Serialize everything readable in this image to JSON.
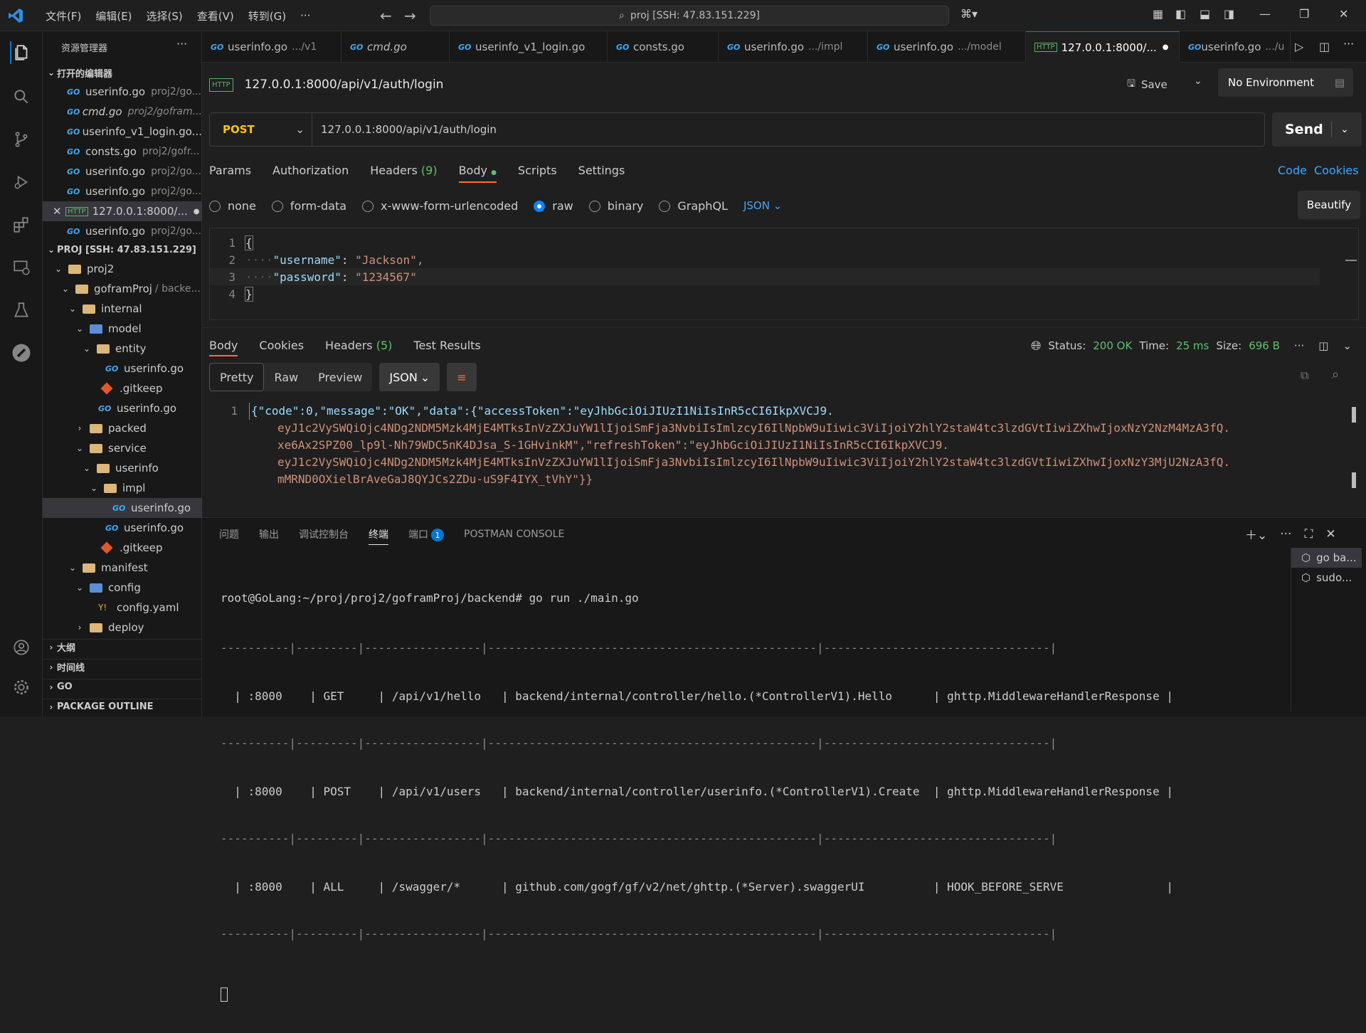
{
  "titlebar": {
    "menu": [
      "文件(F)",
      "编辑(E)",
      "选择(S)",
      "查看(V)",
      "转到(G)",
      "···"
    ],
    "search": "proj [SSH: 47.83.151.229]"
  },
  "sidebar": {
    "header": "资源管理器",
    "open_editors_title": "打开的编辑器",
    "open_editors": [
      {
        "name": "userinfo.go",
        "path": "proj2/go..."
      },
      {
        "name": "cmd.go",
        "path": "proj2/gofram..."
      },
      {
        "name": "userinfo_v1_login.go...",
        "path": ""
      },
      {
        "name": "consts.go",
        "path": "proj2/gofr..."
      },
      {
        "name": "userinfo.go",
        "path": "proj2/go..."
      },
      {
        "name": "userinfo.go",
        "path": "proj2/go..."
      },
      {
        "name": "127.0.0.1:8000/...",
        "path": ""
      },
      {
        "name": "userinfo.go",
        "path": "proj2/go..."
      }
    ],
    "proj_title": "PROJ [SSH: 47.83.151.229]",
    "tree": [
      {
        "label": "proj2"
      },
      {
        "label": "goframProj",
        "path": "/ backe..."
      },
      {
        "label": "internal"
      },
      {
        "label": "model"
      },
      {
        "label": "entity"
      },
      {
        "label": "userinfo.go"
      },
      {
        "label": ".gitkeep"
      },
      {
        "label": "userinfo.go"
      },
      {
        "label": "packed"
      },
      {
        "label": "service"
      },
      {
        "label": "userinfo"
      },
      {
        "label": "impl"
      },
      {
        "label": "userinfo.go"
      },
      {
        "label": "userinfo.go"
      },
      {
        "label": ".gitkeep"
      },
      {
        "label": "manifest"
      },
      {
        "label": "config"
      },
      {
        "label": "config.yaml"
      },
      {
        "label": "deploy"
      }
    ],
    "bottom_sections": [
      "大纲",
      "时间线",
      "GO",
      "PACKAGE OUTLINE"
    ]
  },
  "tabs": [
    {
      "name": "userinfo.go",
      "path": ".../v1"
    },
    {
      "name": "cmd.go",
      "path": ""
    },
    {
      "name": "userinfo_v1_login.go",
      "path": ""
    },
    {
      "name": "consts.go",
      "path": ""
    },
    {
      "name": "userinfo.go",
      "path": ".../impl"
    },
    {
      "name": "userinfo.go",
      "path": ".../model"
    },
    {
      "name": "127.0.0.1:8000/...",
      "path": ""
    },
    {
      "name": "userinfo.go",
      "path": ".../u"
    }
  ],
  "request": {
    "title": "127.0.0.1:8000/api/v1/auth/login",
    "save": "Save",
    "environment": "No Environment",
    "method": "POST",
    "url": "127.0.0.1:8000/api/v1/auth/login",
    "send": "Send",
    "subtabs": {
      "params": "Params",
      "authorization": "Authorization",
      "headers": "Headers",
      "headers_count": "(9)",
      "body": "Body",
      "scripts": "Scripts",
      "settings": "Settings"
    },
    "code": "Code",
    "cookies": "Cookies",
    "body_types": [
      "none",
      "form-data",
      "x-www-form-urlencoded",
      "raw",
      "binary",
      "GraphQL"
    ],
    "body_format": "JSON",
    "beautify": "Beautify",
    "body_lines": [
      {
        "n": "1",
        "text": "{"
      },
      {
        "n": "2",
        "key": "\"username\"",
        "value": "\"Jackson\","
      },
      {
        "n": "3",
        "key": "\"password\"",
        "value": "\"1234567\""
      },
      {
        "n": "4",
        "text": "}"
      }
    ]
  },
  "response": {
    "tabs": {
      "body": "Body",
      "cookies": "Cookies",
      "headers": "Headers",
      "headers_count": "(5)",
      "tests": "Test Results"
    },
    "status_label": "Status:",
    "status": "200 OK",
    "time_label": "Time:",
    "time": "25 ms",
    "size_label": "Size:",
    "size": "696 B",
    "views": [
      "Pretty",
      "Raw",
      "Preview"
    ],
    "format": "JSON",
    "line_no": "1",
    "lines": [
      "{\"code\":0,\"message\":\"OK\",\"data\":{\"accessToken\":\"eyJhbGciOiJIUzI1NiIsInR5cCI6IkpXVCJ9.",
      "eyJ1c2VySWQiOjc4NDg2NDM5Mzk4MjE4MTksInVzZXJuYW1lIjoiSmFja3NvbiIsImlzcyI6IlNpbW9uIiwic3ViIjoiY2hlY2staW4tc3lzdGVtIiwiZXhwIjoxNzY2NzM4MzA3fQ.",
      "xe6Ax2SPZ00_lp9l-Nh79WDC5nK4DJsa_S-1GHvinkM\",\"refreshToken\":\"eyJhbGciOiJIUzI1NiIsInR5cCI6IkpXVCJ9.",
      "eyJ1c2VySWQiOjc4NDg2NDM5Mzk4MjE4MTksInVzZXJuYW1lIjoiSmFja3NvbiIsImlzcyI6IlNpbW9uIiwic3ViIjoiY2hlY2staW4tc3lzdGVtIiwiZXhwIjoxNzY3MjU2NzA3fQ.",
      "mMRND0OXielBrAveGaJ8QYJCs2ZDu-uS9F4IYX_tVhY\"}}"
    ]
  },
  "panel": {
    "tabs": [
      "问题",
      "输出",
      "调试控制台",
      "终端",
      "端口",
      "POSTMAN CONSOLE"
    ],
    "port_badge": "1",
    "terminal_lines": [
      "root@GoLang:~/proj/proj2/goframProj/backend# go run ./main.go",
      "----------|---------|-----------------|------------------------------------------------|---------------------------------|",
      "  | :8000    | GET     | /api/v1/hello   | backend/internal/controller/hello.(*ControllerV1).Hello      | ghttp.MiddlewareHandlerResponse |",
      "----------|---------|-----------------|------------------------------------------------|---------------------------------|",
      "  | :8000    | POST    | /api/v1/users   | backend/internal/controller/userinfo.(*ControllerV1).Create  | ghttp.MiddlewareHandlerResponse |",
      "----------|---------|-----------------|------------------------------------------------|---------------------------------|",
      "  | :8000    | ALL     | /swagger/*      | github.com/gogf/gf/v2/net/ghttp.(*Server).swaggerUI          | HOOK_BEFORE_SERVE               |",
      "----------|---------|-----------------|------------------------------------------------|---------------------------------|"
    ],
    "terminals": [
      "go ba...",
      "sudo..."
    ]
  },
  "colors": {
    "accent": "#0078d4",
    "status_ok": "#5dc16b",
    "post": "#ffc600"
  }
}
